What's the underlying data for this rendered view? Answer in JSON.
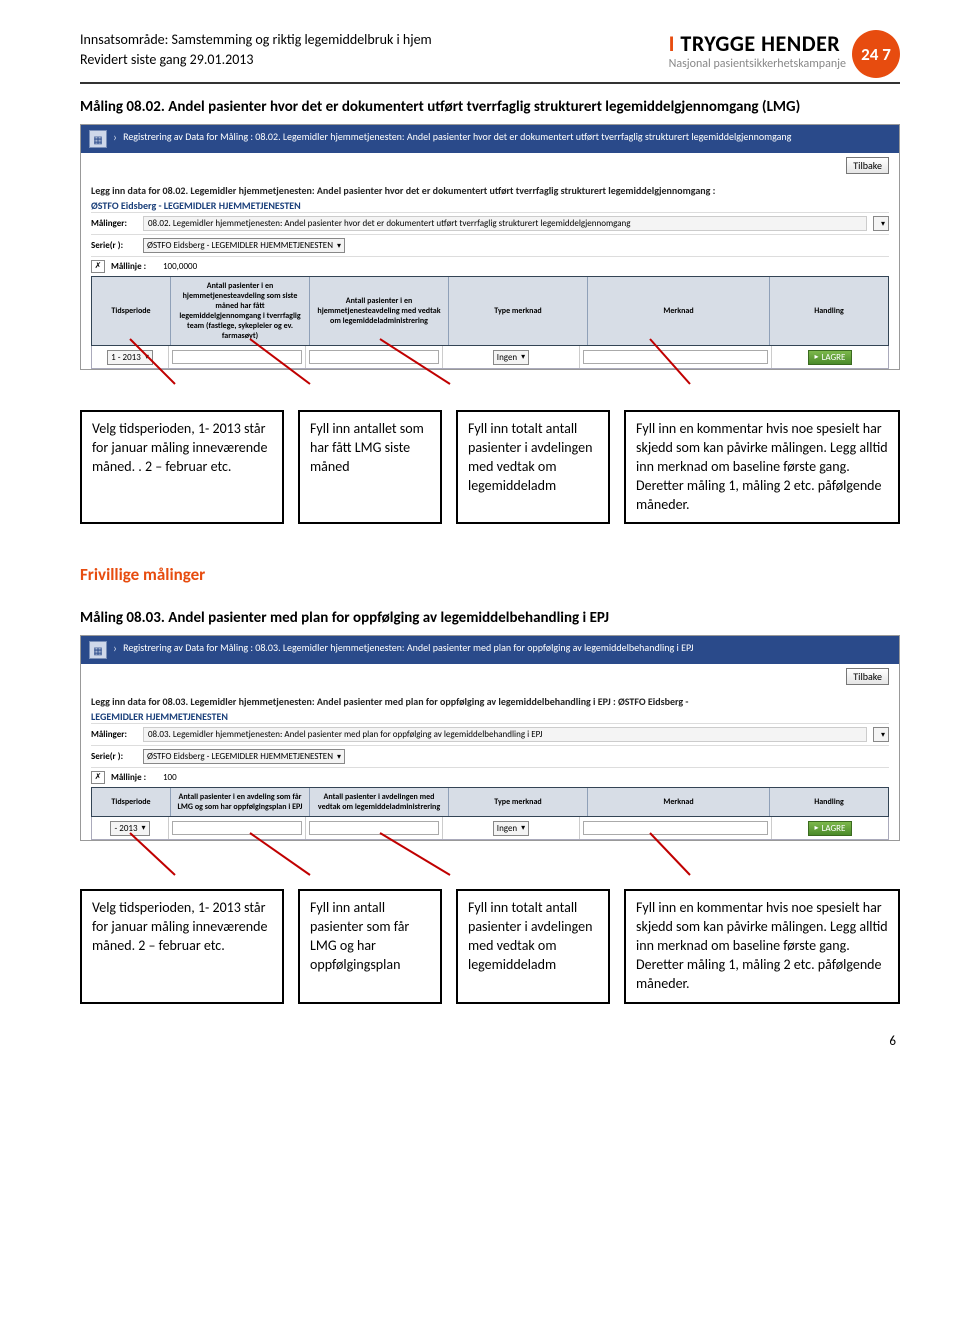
{
  "header": {
    "line1": "Innsatsområde: Samstemming og riktig legemiddelbruk i hjem",
    "line2": "Revidert siste gang 29.01.2013",
    "logo_title_pre": "I ",
    "logo_title_main": "TRYGGE HENDER",
    "logo_sub": "Nasjonal pasientsikkerhetskampanje",
    "logo_badge": "24 7"
  },
  "section1": {
    "heading": "Måling 08.02. Andel pasienter hvor det er dokumentert utført tverrfaglig strukturert legemiddelgjennomgang (LMG)",
    "shot": {
      "bluebar": "Registrering av Data for Måling : 08.02. Legemidler hjemmetjenesten: Andel pasienter hvor det er dokumentert utført tverrfaglig strukturert legemiddelgjennomgang",
      "tilbake": "Tilbake",
      "legg": "Legg inn data for 08.02. Legemidler hjemmetjenesten: Andel pasienter hvor det er dokumentert utført tverrfaglig strukturert legemiddelgjennomgang :",
      "org": "ØSTFO Eidsberg - LEGEMIDLER HJEMMETJENESTEN",
      "malinger_lbl": "Målinger:",
      "malinger_val": "08.02. Legemidler hjemmetjenesten: Andel pasienter hvor det er dokumentert utført tverrfaglig strukturert legemiddelgjennomgang",
      "serie_lbl": "Serie(r ):",
      "serie_val": "ØSTFO Eidsberg - LEGEMIDLER HJEMMETJENESTEN",
      "mallinje_lbl": "Mållinje :",
      "mallinje_val": "100,0000",
      "cols": {
        "c1": "Tidsperiode",
        "c2": "Antall pasienter i en hjemmetjenesteavdeling som siste måned har fått legemiddelgjennomgang i tverrfaglig team (fastlege, sykepleier og ev. farmasøyt)",
        "c3": "Antall pasienter i en hjemmetjenesteavdeling med vedtak om legemiddeladministrering",
        "c4": "Type merknad",
        "c5": "Merknad",
        "c6": "Handling"
      },
      "period": "1 - 2013",
      "type_val": "Ingen",
      "lagre": "LAGRE"
    },
    "anno": {
      "a": "Velg tidsperioden, 1- 2013 står for januar måling inneværende måned. . 2 – februar etc.",
      "b": "Fyll inn antallet som har fått LMG siste måned",
      "c": "Fyll inn totalt antall pasienter i avdelingen med vedtak om legemiddeladm",
      "d": "Fyll inn en kommentar hvis noe spesielt har skjedd som kan påvirke målingen. Legg alltid inn merknad om baseline første gang. Deretter måling 1, måling 2 etc. påfølgende måneder."
    }
  },
  "frivillige_heading": "Frivillige målinger",
  "section2": {
    "heading": "Måling 08.03. Andel pasienter med plan for oppfølging av legemiddelbehandling i EPJ",
    "shot": {
      "bluebar": "Registrering av Data for Måling : 08.03. Legemidler hjemmetjenesten: Andel pasienter med plan for oppfølging av legemiddelbehandling i EPJ",
      "tilbake": "Tilbake",
      "legg": "Legg inn data for 08.03. Legemidler hjemmetjenesten: Andel pasienter med plan for oppfølging av legemiddelbehandling i EPJ : ØSTFO Eidsberg -",
      "org": "LEGEMIDLER HJEMMETJENESTEN",
      "malinger_lbl": "Målinger:",
      "malinger_val": "08.03. Legemidler hjemmetjenesten: Andel pasienter med plan for oppfølging av legemiddelbehandling i EPJ",
      "serie_lbl": "Serie(r ):",
      "serie_val": "ØSTFO Eidsberg - LEGEMIDLER HJEMMETJENESTEN",
      "mallinje_lbl": "Mållinje :",
      "mallinje_val": "100",
      "cols": {
        "c1": "Tidsperiode",
        "c2": "Antall pasienter i en avdeling som får LMG og som har oppfølgingsplan i EPJ",
        "c3": "Antall pasienter i avdelingen med vedtak om legemiddeladministrering",
        "c4": "Type merknad",
        "c5": "Merknad",
        "c6": "Handling"
      },
      "period": "- 2013",
      "type_val": "Ingen",
      "lagre": "LAGRE"
    },
    "anno": {
      "a": "Velg tidsperioden, 1- 2013 står for januar måling inneværende måned. 2 – februar etc.",
      "b": "Fyll inn antall pasienter som får LMG og har oppfølgingsplan",
      "c": "Fyll inn totalt antall pasienter i avdelingen med vedtak om legemiddeladm",
      "d": "Fyll inn en kommentar hvis noe spesielt har skjedd som kan påvirke målingen. Legg alltid inn merknad om baseline første gang. Deretter måling 1, måling 2 etc. påfølgende måneder."
    }
  },
  "pagenum": "6"
}
